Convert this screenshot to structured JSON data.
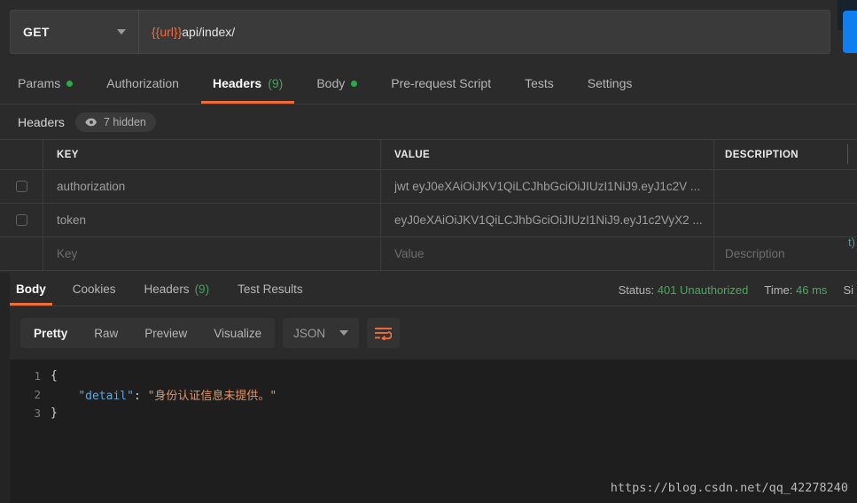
{
  "request": {
    "method": "GET",
    "url_variable": "{{url}}",
    "url_path": "api/index/",
    "tabs": [
      {
        "label": "Params",
        "dot": true,
        "active": false,
        "count": ""
      },
      {
        "label": "Authorization",
        "dot": false,
        "active": false,
        "count": ""
      },
      {
        "label": "Headers",
        "dot": false,
        "active": true,
        "count": "(9)"
      },
      {
        "label": "Body",
        "dot": true,
        "active": false,
        "count": ""
      },
      {
        "label": "Pre-request Script",
        "dot": false,
        "active": false,
        "count": ""
      },
      {
        "label": "Tests",
        "dot": false,
        "active": false,
        "count": ""
      },
      {
        "label": "Settings",
        "dot": false,
        "active": false,
        "count": ""
      }
    ]
  },
  "headers_panel": {
    "title": "Headers",
    "hidden_label": "7 hidden",
    "columns": [
      "KEY",
      "VALUE",
      "DESCRIPTION"
    ],
    "rows": [
      {
        "key": "authorization",
        "value": "jwt eyJ0eXAiOiJKV1QiLCJhbGciOiJIUzI1NiJ9.eyJ1c2V ...",
        "description": ""
      },
      {
        "key": "token",
        "value": "eyJ0eXAiOiJKV1QiLCJhbGciOiJIUzI1NiJ9.eyJ1c2VyX2 ...",
        "description": ""
      }
    ],
    "new_row": {
      "key_placeholder": "Key",
      "value_placeholder": "Value",
      "description_placeholder": "Description"
    },
    "side_fragment": "t)"
  },
  "response": {
    "tabs": [
      {
        "label": "Body",
        "active": true,
        "count": ""
      },
      {
        "label": "Cookies",
        "active": false,
        "count": ""
      },
      {
        "label": "Headers",
        "active": false,
        "count": "(9)"
      },
      {
        "label": "Test Results",
        "active": false,
        "count": ""
      }
    ],
    "status_label": "Status:",
    "status_value": "401 Unauthorized",
    "time_label": "Time:",
    "time_value": "46 ms",
    "size_label": "Si",
    "view_modes": [
      {
        "label": "Pretty",
        "active": true
      },
      {
        "label": "Raw",
        "active": false
      },
      {
        "label": "Preview",
        "active": false
      },
      {
        "label": "Visualize",
        "active": false
      }
    ],
    "format": "JSON",
    "wrap_icon": "word-wrap-icon",
    "body": {
      "lines": [
        {
          "num": "1",
          "brace": "{",
          "key": "",
          "colon": "",
          "str": ""
        },
        {
          "num": "2",
          "brace": "",
          "key": "\"detail\"",
          "colon": ": ",
          "str": "\"身份认证信息未提供。\""
        },
        {
          "num": "3",
          "brace": "}",
          "key": "",
          "colon": "",
          "str": ""
        }
      ]
    }
  },
  "watermark": "https://blog.csdn.net/qq_42278240",
  "colors": {
    "accent": "#f26b3a",
    "success": "#2aab49",
    "status_green": "#4ba85f",
    "send_blue": "#0f7ef0",
    "json_key": "#5ba7e0",
    "json_string": "#e0956a"
  }
}
